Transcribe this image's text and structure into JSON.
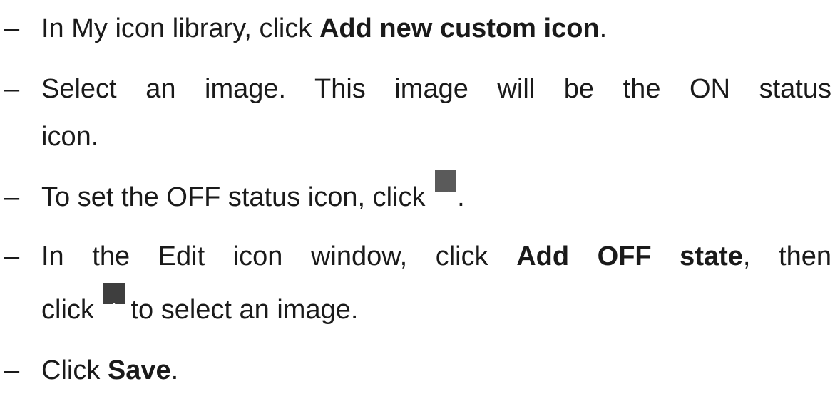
{
  "steps": [
    {
      "dash": "–",
      "pre": "In My icon library, click ",
      "bold": "Add new custom icon",
      "post": "."
    },
    {
      "dash": "–",
      "line1": "Select an image. This image will be the ON status",
      "line2": "icon."
    },
    {
      "dash": "–",
      "pre": "To set the OFF status icon, click ",
      "icon": "pencil-edit-icon",
      "post": "."
    },
    {
      "dash": "–",
      "pre": "In the Edit icon window, click ",
      "bold": "Add OFF state",
      "post": ", then",
      "line2_pre": "click ",
      "icon": "plus-icon",
      "line2_post": "to select an image."
    },
    {
      "dash": "–",
      "pre": "Click ",
      "bold": "Save",
      "post": "."
    }
  ]
}
